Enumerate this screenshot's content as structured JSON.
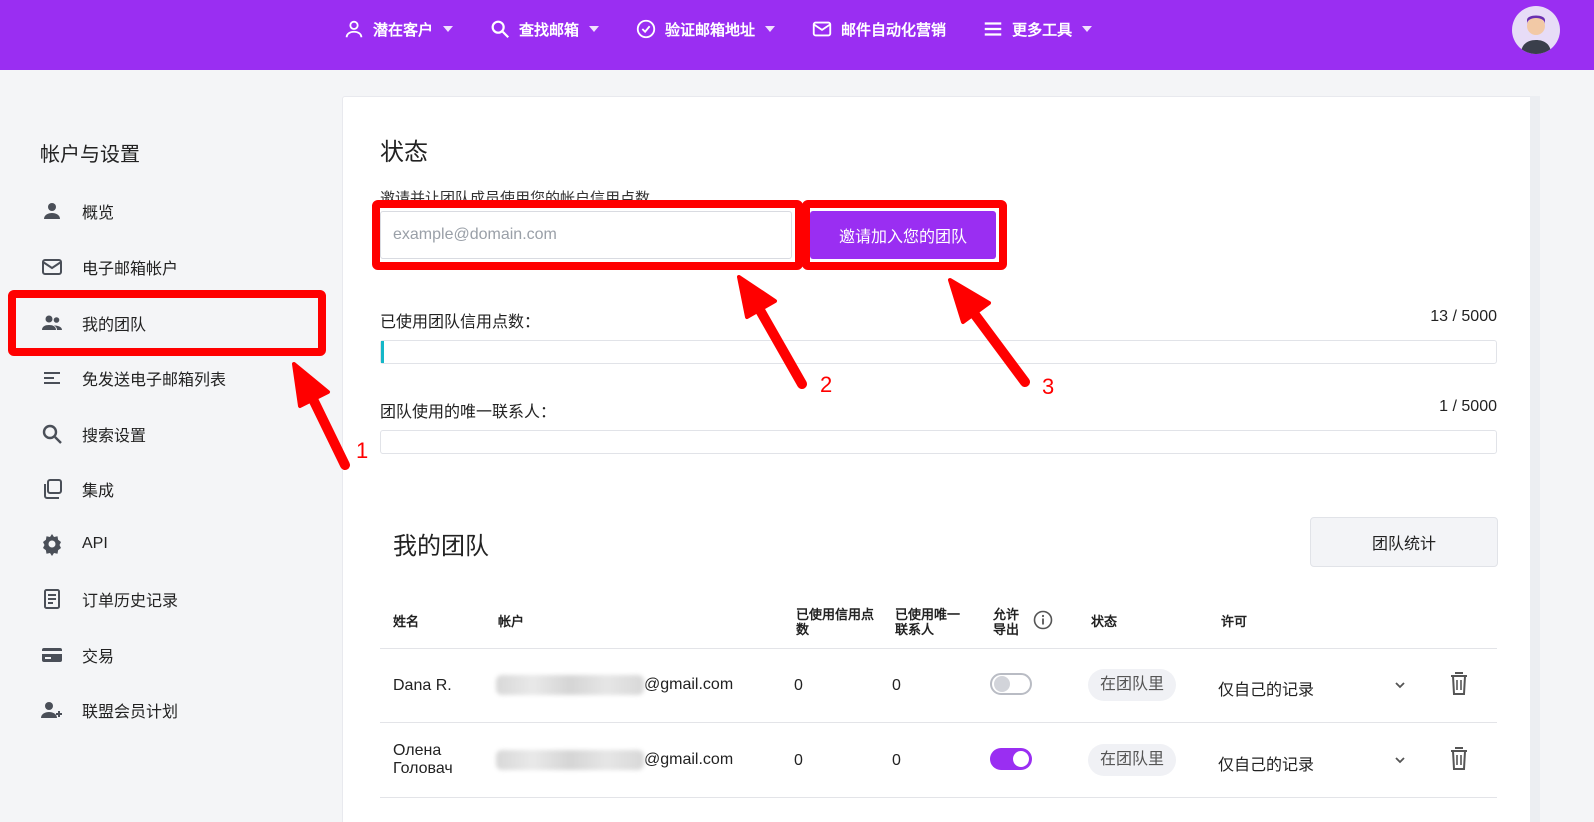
{
  "nav": {
    "items": [
      {
        "label": "潜在客户",
        "icon": "person-icon"
      },
      {
        "label": "查找邮箱",
        "icon": "search-icon"
      },
      {
        "label": "验证邮箱地址",
        "icon": "check-circle-icon"
      },
      {
        "label": "邮件自动化营销",
        "icon": "mail-icon"
      },
      {
        "label": "更多工具",
        "icon": "menu-icon"
      }
    ]
  },
  "sidebar": {
    "title": "帐户与设置",
    "items": [
      {
        "label": "概览",
        "icon": "person-icon"
      },
      {
        "label": "电子邮箱帐户",
        "icon": "mail-icon"
      },
      {
        "label": "我的团队",
        "icon": "team-icon"
      },
      {
        "label": "免发送电子邮箱列表",
        "icon": "list-icon"
      },
      {
        "label": "搜索设置",
        "icon": "search-icon"
      },
      {
        "label": "集成",
        "icon": "integration-icon"
      },
      {
        "label": "API",
        "icon": "gear-icon"
      },
      {
        "label": "订单历史记录",
        "icon": "document-icon"
      },
      {
        "label": "交易",
        "icon": "card-icon"
      },
      {
        "label": "联盟会员计划",
        "icon": "add-person-icon"
      }
    ]
  },
  "status": {
    "title": "状态",
    "invite_description": "邀请并让团队成员使用您的帐户信用点数",
    "email_placeholder": "example@domain.com",
    "invite_button": "邀请加入您的团队",
    "credits_label": "已使用团队信用点数：",
    "credits_value": "13 / 5000",
    "credits_fraction": 0.0026,
    "contacts_label": "团队使用的唯一联系人：",
    "contacts_value": "1 / 5000",
    "contacts_fraction": 0.0002
  },
  "team": {
    "title": "我的团队",
    "stats_button": "团队统计",
    "headers": {
      "name": "姓名",
      "account": "帐户",
      "credits_used": "已使用信用点数",
      "contacts_used": "已使用唯一联系人",
      "allow_export": "允许导出",
      "status": "状态",
      "permission": "许可"
    },
    "rows": [
      {
        "name": "Dana R.",
        "email_domain": "@gmail.com",
        "credits": "0",
        "contacts": "0",
        "export": false,
        "status": "在团队里",
        "permission": "仅自己的记录"
      },
      {
        "name": "Олена Головач",
        "email_domain": "@gmail.com",
        "credits": "0",
        "contacts": "0",
        "export": true,
        "status": "在团队里",
        "permission": "仅自己的记录"
      }
    ]
  },
  "annotations": [
    "1",
    "2",
    "3"
  ],
  "colors": {
    "brand": "#9a2ef2",
    "annotation": "#ff0000",
    "progress": "#14b7c8"
  }
}
